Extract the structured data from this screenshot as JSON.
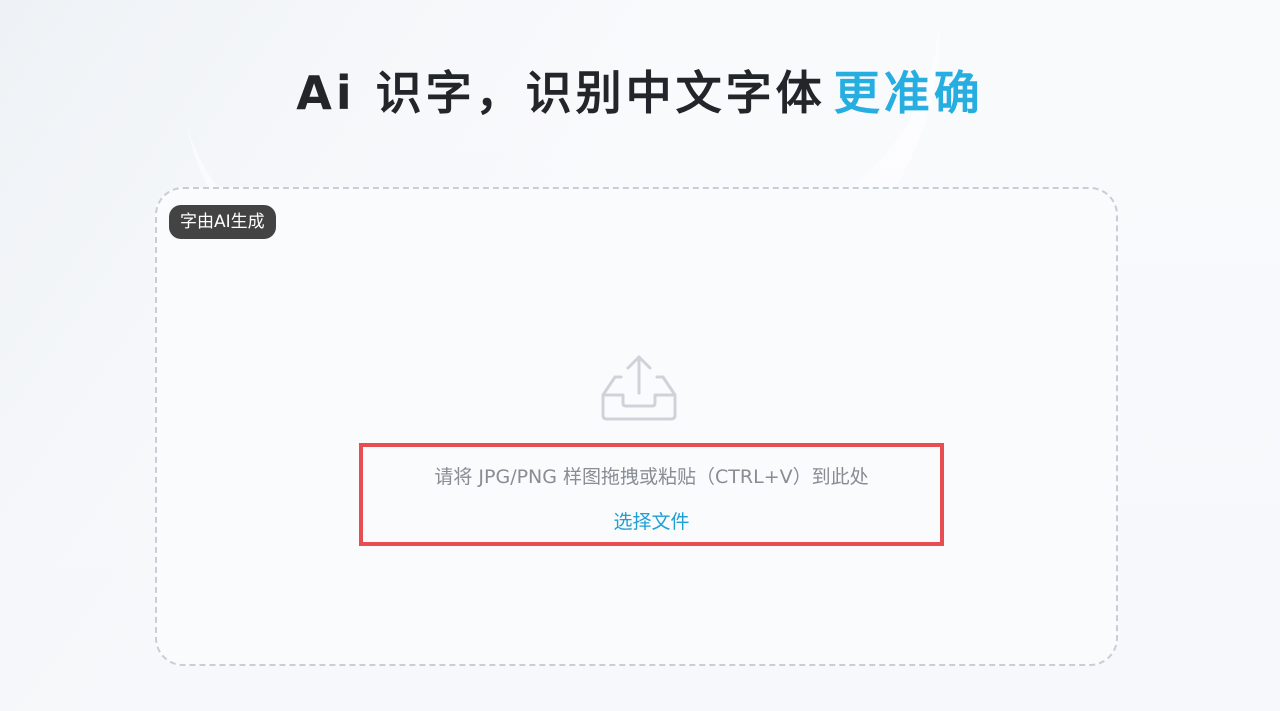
{
  "headline": {
    "main": "Ai 识字，识别中文字体",
    "accent": "更准确"
  },
  "dropzone": {
    "badge": "字由AI生成",
    "icon": "upload-tray-icon",
    "hint": "请将 JPG/PNG 样图拖拽或粘贴（CTRL+V）到此处",
    "choose_file": "选择文件"
  },
  "colors": {
    "accent": "#26aee0",
    "link": "#1f9fd6",
    "highlight_border": "#e84d52",
    "badge_bg": "#434343"
  }
}
